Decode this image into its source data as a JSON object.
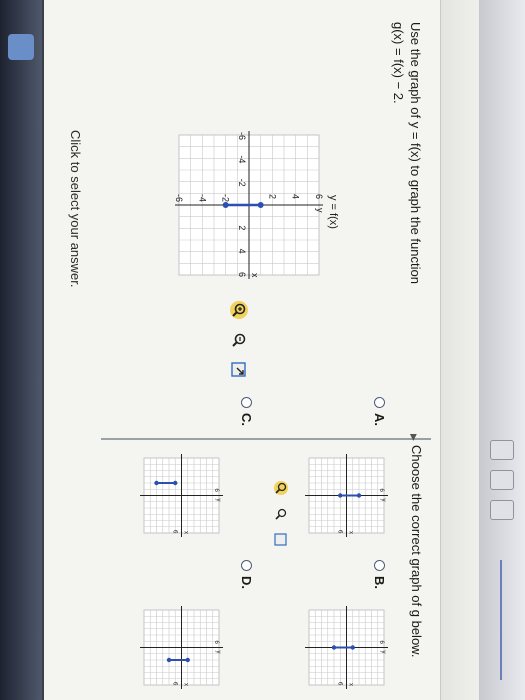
{
  "question": {
    "line1": "Use the graph of y = f(x) to graph the function",
    "line2": "g(x) = f(x) − 2."
  },
  "prompt": "Choose the correct graph of g below.",
  "graph_title": "y = f(x)",
  "hint": "Click to select your answer.",
  "axes": {
    "x_label": "x",
    "y_label": "y"
  },
  "main_graph": {
    "ticks": [
      "-6",
      "-4",
      "-2",
      "2",
      "4",
      "6"
    ],
    "range": [
      -6,
      6
    ],
    "segment": {
      "x": 0,
      "y": [
        -2,
        1
      ]
    }
  },
  "options": [
    {
      "id": "A",
      "label": "A.",
      "tick": "6",
      "segment": {
        "x": 0,
        "y": [
          -1,
          2
        ]
      }
    },
    {
      "id": "B",
      "label": "B.",
      "tick": "6",
      "segment": {
        "x": 0,
        "y": [
          -2,
          1
        ]
      }
    },
    {
      "id": "C",
      "label": "C.",
      "tick": "6",
      "segment": {
        "x": -2,
        "y": [
          -4,
          -1
        ]
      }
    },
    {
      "id": "D",
      "label": "D.",
      "tick": "6",
      "segment": {
        "x": 2,
        "y": [
          -2,
          1
        ]
      }
    }
  ],
  "colors": {
    "segment": "#2d4fb0",
    "grid": "#c9c9c9",
    "axis": "#222222",
    "accent": "#2f6fc0"
  },
  "icons": [
    "zoom-in-icon",
    "zoom-out-icon",
    "popout-icon"
  ]
}
